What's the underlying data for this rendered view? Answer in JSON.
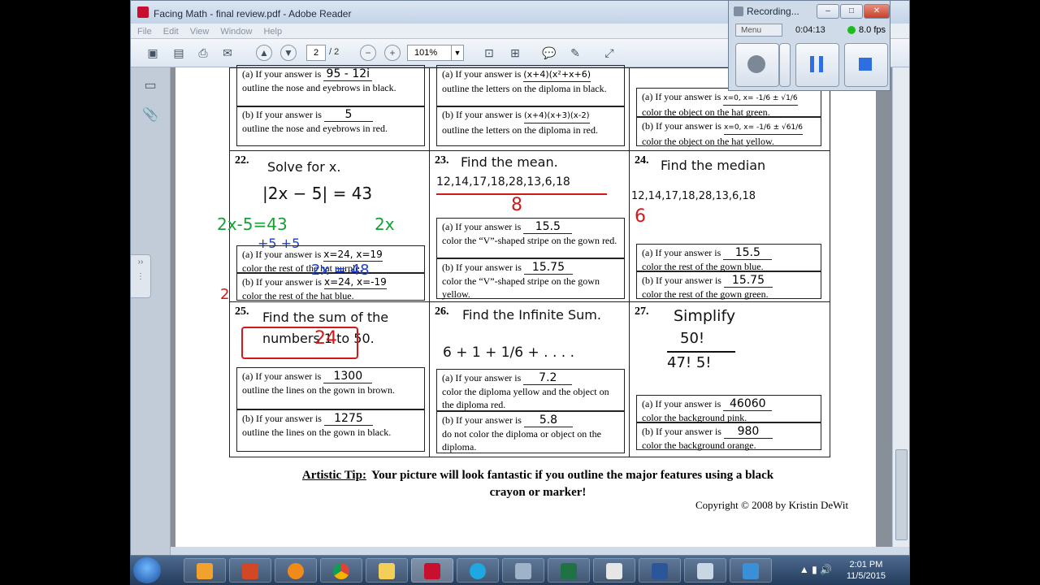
{
  "window": {
    "title": "Facing Math - final review.pdf - Adobe Reader"
  },
  "menu": [
    "File",
    "Edit",
    "View",
    "Window",
    "Help"
  ],
  "toolbar": {
    "page_current": "2",
    "page_total": "/ 2",
    "zoom": "101%"
  },
  "worksheet": {
    "row1": {
      "c1": {
        "a_text": "(a) If your answer is",
        "a_ans": "95 - 12i",
        "a_desc": "outline the nose and eyebrows in black.",
        "b_text": "(b) If your answer is",
        "b_ans": "5",
        "b_desc": "outline the nose and eyebrows in red."
      },
      "c2": {
        "a_text": "(a) If your answer is",
        "a_ans": "(x+4)(x²+x+6)",
        "a_desc": "outline the letters on the diploma in black.",
        "b_text": "(b) If your answer is",
        "b_ans": "(x+4)(x+3)(x-2)",
        "b_desc": "outline the letters on the diploma in red."
      },
      "c3": {
        "a_text": "(a) If your answer is",
        "a_ans": "x=0, x= -1/6 ± √1/6",
        "a_desc": "color the object on the hat green.",
        "b_text": "(b) If your answer is",
        "b_ans": "x=0, x= -1/6 ± √61/6",
        "b_desc": "color the object on the hat yellow."
      }
    },
    "row2": {
      "c1": {
        "num": "22.",
        "prompt": "Solve for x.",
        "equation": "|2x − 5| = 43",
        "work_green": "2x-5=43",
        "work_green2": "2x",
        "work_blue": "+5 +5",
        "work_blue2": "2x = 48",
        "work_red": "2",
        "a_text": "(a) If your answer is",
        "a_ans": "x=24, x=19",
        "a_desc": "color the rest of the hat purple.",
        "b_text": "(b) If your answer is",
        "b_ans": "x=24, x=-19",
        "b_desc": "color the rest of the hat blue."
      },
      "c2": {
        "num": "23.",
        "prompt": "Find the mean.",
        "numbers": "12,14,17,18,28,13,6,18",
        "result": "8",
        "a_text": "(a) If your answer is",
        "a_ans": "15.5",
        "a_desc": "color the “V”-shaped stripe on the gown red.",
        "b_text": "(b) If your answer is",
        "b_ans": "15.75",
        "b_desc": "color the “V”-shaped stripe on the gown yellow."
      },
      "c3": {
        "num": "24.",
        "prompt": "Find the median",
        "numbers": "12,14,17,18,28,13,6,18",
        "result": "6",
        "a_text": "(a) If your answer is",
        "a_ans": "15.5",
        "a_desc": "color the rest of the gown blue.",
        "b_text": "(b) If your answer is",
        "b_ans": "15.75",
        "b_desc": "color the rest of the gown green."
      }
    },
    "row3": {
      "c1": {
        "num": "25.",
        "prompt": "Find the sum of the numbers 1 to 50.",
        "work_red": "24",
        "a_text": "(a) If your answer is",
        "a_ans": "1300",
        "a_desc": "outline the lines on the gown in brown.",
        "b_text": "(b) If your answer is",
        "b_ans": "1275",
        "b_desc": "outline the lines on the gown in black."
      },
      "c2": {
        "num": "26.",
        "prompt": "Find the Infinite Sum.",
        "series": "6 + 1 + 1/6 + . . . .",
        "a_text": "(a) If your answer is",
        "a_ans": "7.2",
        "a_desc": "color the diploma yellow and the object on the diploma red.",
        "b_text": "(b) If your answer is",
        "b_ans": "5.8",
        "b_desc": "do not color the diploma or object on the diploma."
      },
      "c3": {
        "num": "27.",
        "prompt": "Simplify",
        "numer": "50!",
        "denom": "47! 5!",
        "a_text": "(a) If your answer is",
        "a_ans": "46060",
        "a_desc": "color the background pink.",
        "b_text": "(b) If your answer is",
        "b_ans": "980",
        "b_desc": "color the background orange."
      }
    },
    "tip_label": "Artistic Tip:",
    "tip_text": "Your picture will look fantastic if you outline the major features using a black crayon or marker!",
    "copyright": "Copyright © 2008 by Kristin DeWit"
  },
  "recorder": {
    "title": "Recording...",
    "menu": "Menu",
    "time": "0:04:13",
    "fps": "8.0 fps"
  },
  "taskbar": {
    "time": "2:01 PM",
    "date": "11/5/2015"
  },
  "colors": {
    "annotation_red": "#d21919",
    "annotation_green": "#17a036",
    "annotation_blue": "#1a3fd6"
  }
}
